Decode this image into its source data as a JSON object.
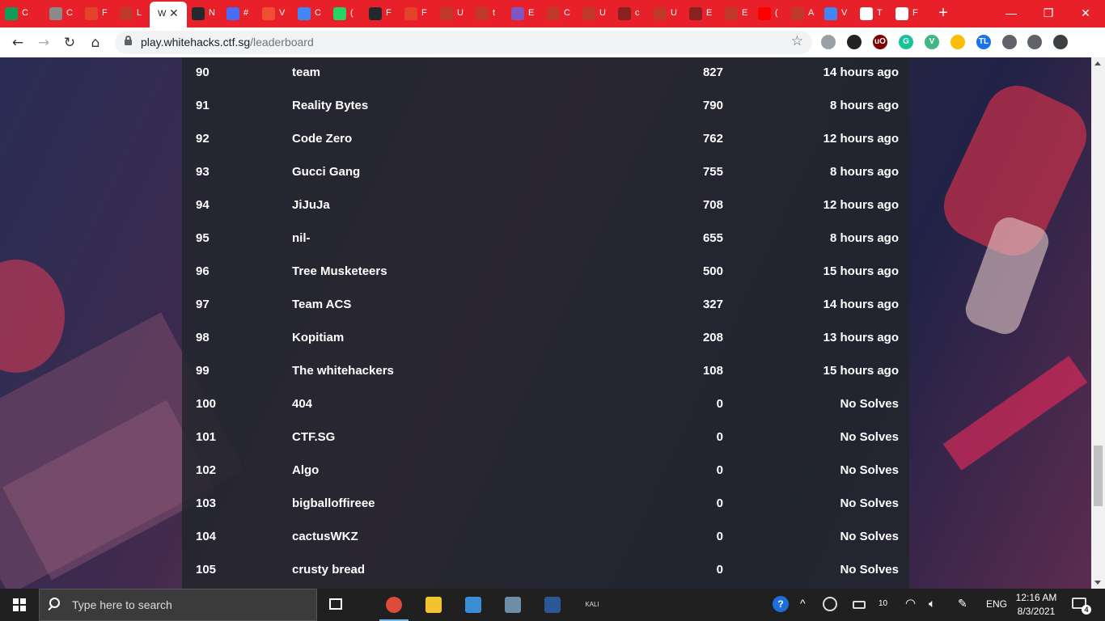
{
  "browser": {
    "tabs": [
      {
        "icon": "sheets-icon",
        "label": "C",
        "color": "#0f9d58"
      },
      {
        "icon": "globe-icon",
        "label": "C",
        "color": "#8a8a8a"
      },
      {
        "icon": "gitlab-icon",
        "label": "F",
        "color": "#e24329"
      },
      {
        "icon": "globe-icon",
        "label": "L",
        "color": "#c0392b"
      },
      {
        "icon": "ctf-icon",
        "label": "W",
        "color": "#ffffff",
        "active": true
      },
      {
        "icon": "github-icon",
        "label": "N",
        "color": "#24292e"
      },
      {
        "icon": "app-icon",
        "label": "#",
        "color": "#4a6cf7"
      },
      {
        "icon": "git-icon",
        "label": "V",
        "color": "#f05032"
      },
      {
        "icon": "docs-icon",
        "label": "C",
        "color": "#4285f4"
      },
      {
        "icon": "whatsapp-icon",
        "label": "(",
        "color": "#25d366"
      },
      {
        "icon": "github-icon",
        "label": "F",
        "color": "#24292e"
      },
      {
        "icon": "gitlab-icon",
        "label": "F",
        "color": "#e24329"
      },
      {
        "icon": "send-icon",
        "label": "U",
        "color": "#c0392b"
      },
      {
        "icon": "pin-icon",
        "label": "t",
        "color": "#c0392b"
      },
      {
        "icon": "forms-icon",
        "label": "E",
        "color": "#7e57c2"
      },
      {
        "icon": "grammarly-icon",
        "label": "C",
        "color": "#c0392b"
      },
      {
        "icon": "send-icon",
        "label": "U",
        "color": "#c0392b"
      },
      {
        "icon": "git-icon",
        "label": "c",
        "color": "#8b2020"
      },
      {
        "icon": "grammarly-icon",
        "label": "U",
        "color": "#c0392b"
      },
      {
        "icon": "badge-icon",
        "label": "E",
        "color": "#8b2020"
      },
      {
        "icon": "link-icon",
        "label": "E",
        "color": "#c0392b"
      },
      {
        "icon": "youtube-icon",
        "label": "(",
        "color": "#ff0000"
      },
      {
        "icon": "store-icon",
        "label": "A",
        "color": "#c0392b"
      },
      {
        "icon": "docs-icon",
        "label": "V",
        "color": "#4285f4"
      },
      {
        "icon": "sf-icon",
        "label": "T",
        "color": "#ffffff"
      },
      {
        "icon": "sf-icon",
        "label": "F",
        "color": "#ffffff"
      }
    ],
    "tab_close": "✕",
    "new_tab": "+",
    "minimize": "—",
    "maximize": "❐",
    "close": "✕",
    "url_host": "play.whitehacks.ctf.sg",
    "url_path": "/leaderboard",
    "extensions": [
      {
        "icon": "shield-extension-icon",
        "label": "",
        "color": "#9aa0a6"
      },
      {
        "icon": "mask-extension-icon",
        "label": "",
        "color": "#202124"
      },
      {
        "icon": "ublock-extension-icon",
        "label": "uO",
        "color": "#800000"
      },
      {
        "icon": "grammarly-extension-icon",
        "label": "G",
        "color": "#15c39a"
      },
      {
        "icon": "vue-extension-icon",
        "label": "V",
        "color": "#41b883"
      },
      {
        "icon": "drive-extension-icon",
        "label": "",
        "color": "#fbbc04"
      },
      {
        "icon": "translate-extension-icon",
        "label": "TL",
        "color": "#1a73e8"
      },
      {
        "icon": "puzzle-extension-icon",
        "label": "",
        "color": "#5f6368"
      },
      {
        "icon": "playlist-icon",
        "label": "",
        "color": "#5f6368"
      },
      {
        "icon": "profile-avatar",
        "label": "",
        "color": "#3c4043"
      }
    ]
  },
  "leaderboard": {
    "rows": [
      {
        "rank": "90",
        "team": "team",
        "score": "827",
        "time": "14 hours ago"
      },
      {
        "rank": "91",
        "team": "Reality Bytes",
        "score": "790",
        "time": "8 hours ago"
      },
      {
        "rank": "92",
        "team": "Code Zero",
        "score": "762",
        "time": "12 hours ago"
      },
      {
        "rank": "93",
        "team": "Gucci Gang",
        "score": "755",
        "time": "8 hours ago"
      },
      {
        "rank": "94",
        "team": "JiJuJa",
        "score": "708",
        "time": "12 hours ago"
      },
      {
        "rank": "95",
        "team": "nil-",
        "score": "655",
        "time": "8 hours ago"
      },
      {
        "rank": "96",
        "team": "Tree Musketeers",
        "score": "500",
        "time": "15 hours ago"
      },
      {
        "rank": "97",
        "team": "Team ACS",
        "score": "327",
        "time": "14 hours ago"
      },
      {
        "rank": "98",
        "team": "Kopitiam",
        "score": "208",
        "time": "13 hours ago"
      },
      {
        "rank": "99",
        "team": "The whitehackers",
        "score": "108",
        "time": "15 hours ago"
      },
      {
        "rank": "100",
        "team": "404",
        "score": "0",
        "time": "No Solves"
      },
      {
        "rank": "101",
        "team": "CTF.SG",
        "score": "0",
        "time": "No Solves"
      },
      {
        "rank": "102",
        "team": "Algo",
        "score": "0",
        "time": "No Solves"
      },
      {
        "rank": "103",
        "team": "bigballoffireee",
        "score": "0",
        "time": "No Solves"
      },
      {
        "rank": "104",
        "team": "cactusWKZ",
        "score": "0",
        "time": "No Solves"
      },
      {
        "rank": "105",
        "team": "crusty bread",
        "score": "0",
        "time": "No Solves"
      }
    ]
  },
  "taskbar": {
    "search_placeholder": "Type here to search",
    "apps": [
      {
        "icon": "task-view-icon",
        "open": false
      },
      {
        "icon": "chrome-icon",
        "open": true
      },
      {
        "icon": "file-explorer-icon",
        "open": false
      },
      {
        "icon": "control-panel-icon",
        "open": false
      },
      {
        "icon": "snipping-tool-icon",
        "open": false
      },
      {
        "icon": "powershell-icon",
        "open": false
      },
      {
        "icon": "kali-icon",
        "open": false,
        "label": "KALI"
      }
    ],
    "tray": {
      "language": "ENG",
      "time": "12:16 AM",
      "date": "8/3/2021",
      "notifications": "4"
    }
  }
}
